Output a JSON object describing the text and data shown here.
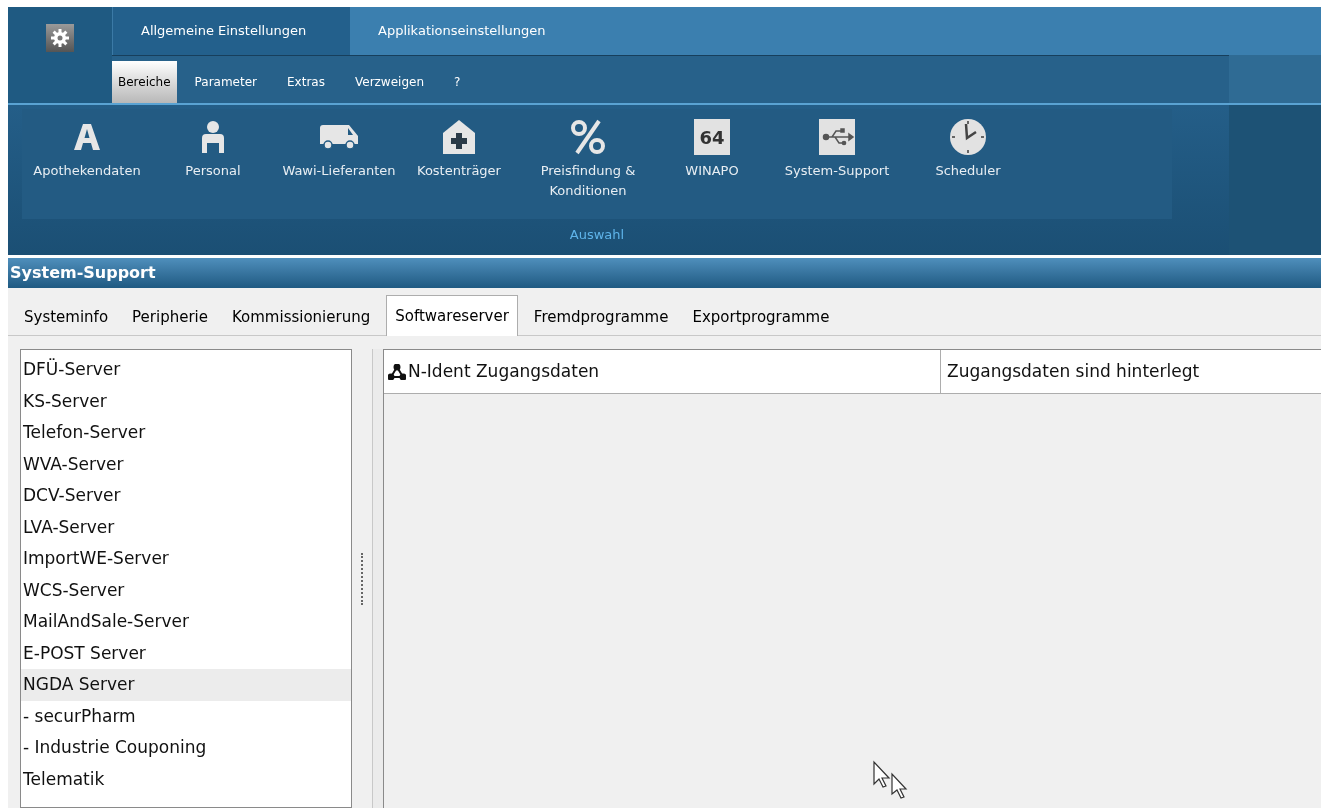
{
  "main_tabs": [
    {
      "label": "Allgemeine Einstellungen",
      "selected": true
    },
    {
      "label": "Applikationseinstellungen",
      "selected": false
    }
  ],
  "sub_tabs": [
    {
      "label": "Bereiche",
      "selected": true
    },
    {
      "label": "Parameter",
      "selected": false
    },
    {
      "label": "Extras",
      "selected": false
    },
    {
      "label": "Verzweigen",
      "selected": false
    },
    {
      "label": "?",
      "selected": false
    }
  ],
  "ribbon": {
    "items": [
      {
        "kind": "letter",
        "label": "Apothekendaten"
      },
      {
        "kind": "person",
        "label": "Personal"
      },
      {
        "kind": "van",
        "label": "Wawi-Lieferanten"
      },
      {
        "kind": "house",
        "label": "Kostenträger"
      },
      {
        "kind": "percent",
        "label": "Preisfindung & Konditionen"
      },
      {
        "kind": "badge",
        "label": "WINAPO",
        "badge": "64"
      },
      {
        "kind": "usb",
        "label": "System-Support"
      },
      {
        "kind": "clock",
        "label": "Scheduler"
      }
    ],
    "group_label": "Auswahl"
  },
  "panel": {
    "title": "System-Support",
    "tabs": [
      {
        "label": "Systeminfo",
        "selected": false
      },
      {
        "label": "Peripherie",
        "selected": false
      },
      {
        "label": "Kommissionierung",
        "selected": false
      },
      {
        "label": "Softwareserver",
        "selected": true
      },
      {
        "label": "Fremdprogramme",
        "selected": false
      },
      {
        "label": "Exportprogramme",
        "selected": false
      }
    ],
    "server_list": [
      {
        "label": "DFÜ-Server",
        "selected": false
      },
      {
        "label": "KS-Server",
        "selected": false
      },
      {
        "label": "Telefon-Server",
        "selected": false
      },
      {
        "label": "WVA-Server",
        "selected": false
      },
      {
        "label": "DCV-Server",
        "selected": false
      },
      {
        "label": "LVA-Server",
        "selected": false
      },
      {
        "label": "ImportWE-Server",
        "selected": false
      },
      {
        "label": "WCS-Server",
        "selected": false
      },
      {
        "label": "MailAndSale-Server",
        "selected": false
      },
      {
        "label": "E-POST Server",
        "selected": false
      },
      {
        "label": "NGDA Server",
        "selected": true
      },
      {
        "label": "- securPharm",
        "selected": false
      },
      {
        "label": "- Industrie Couponing",
        "selected": false
      },
      {
        "label": "Telematik",
        "selected": false
      }
    ],
    "table": {
      "rows": [
        {
          "name": "N-Ident Zugangsdaten",
          "status": "Zugangsdaten sind hinterlegt"
        }
      ]
    }
  }
}
